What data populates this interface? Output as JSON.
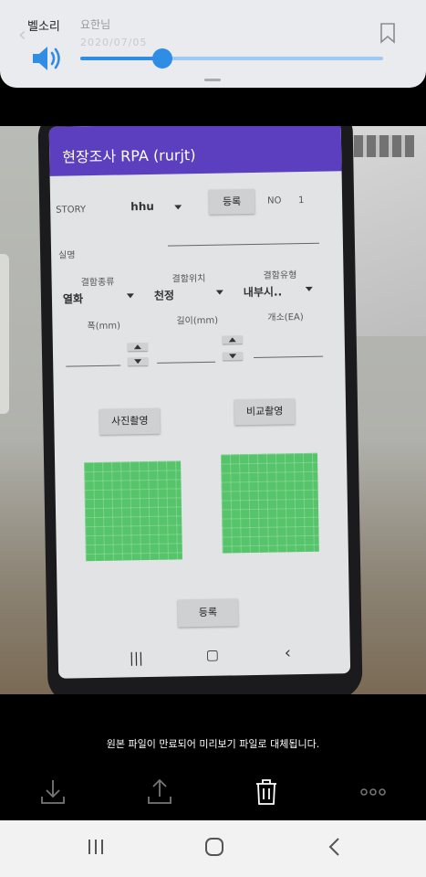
{
  "volume": {
    "label": "벨소리",
    "name": "요한님",
    "date": "2020/07/05",
    "level_percent": 27
  },
  "app": {
    "title": "현장조사 RPA (rurjt)",
    "story_label": "STORY",
    "story_value": "hhu",
    "register_button": "등록",
    "no_label": "NO",
    "no_value": "1",
    "name_label": "실명",
    "defect_type_label": "결함종류",
    "defect_type_value": "열화",
    "defect_location_label": "결함위치",
    "defect_location_value": "천정",
    "defect_kind_label": "결함유형",
    "defect_kind_value": "내부시..",
    "width_label": "폭(mm)",
    "length_label": "길이(mm)",
    "count_label": "개소(EA)",
    "photo_button": "사진촬영",
    "compare_button": "비교촬영",
    "bottom_register_button": "등록"
  },
  "caption": "원본 파일이 만료되어 미리보기 파일로 대체됩니다.",
  "actions": [
    "download-icon",
    "share-icon",
    "delete-icon",
    "more-icon"
  ],
  "system_nav": [
    "recents-icon",
    "home-icon",
    "back-icon"
  ],
  "colors": {
    "accent": "#2f8de6",
    "appbar": "#5b3fbf",
    "image_placeholder": "#56c46a"
  }
}
